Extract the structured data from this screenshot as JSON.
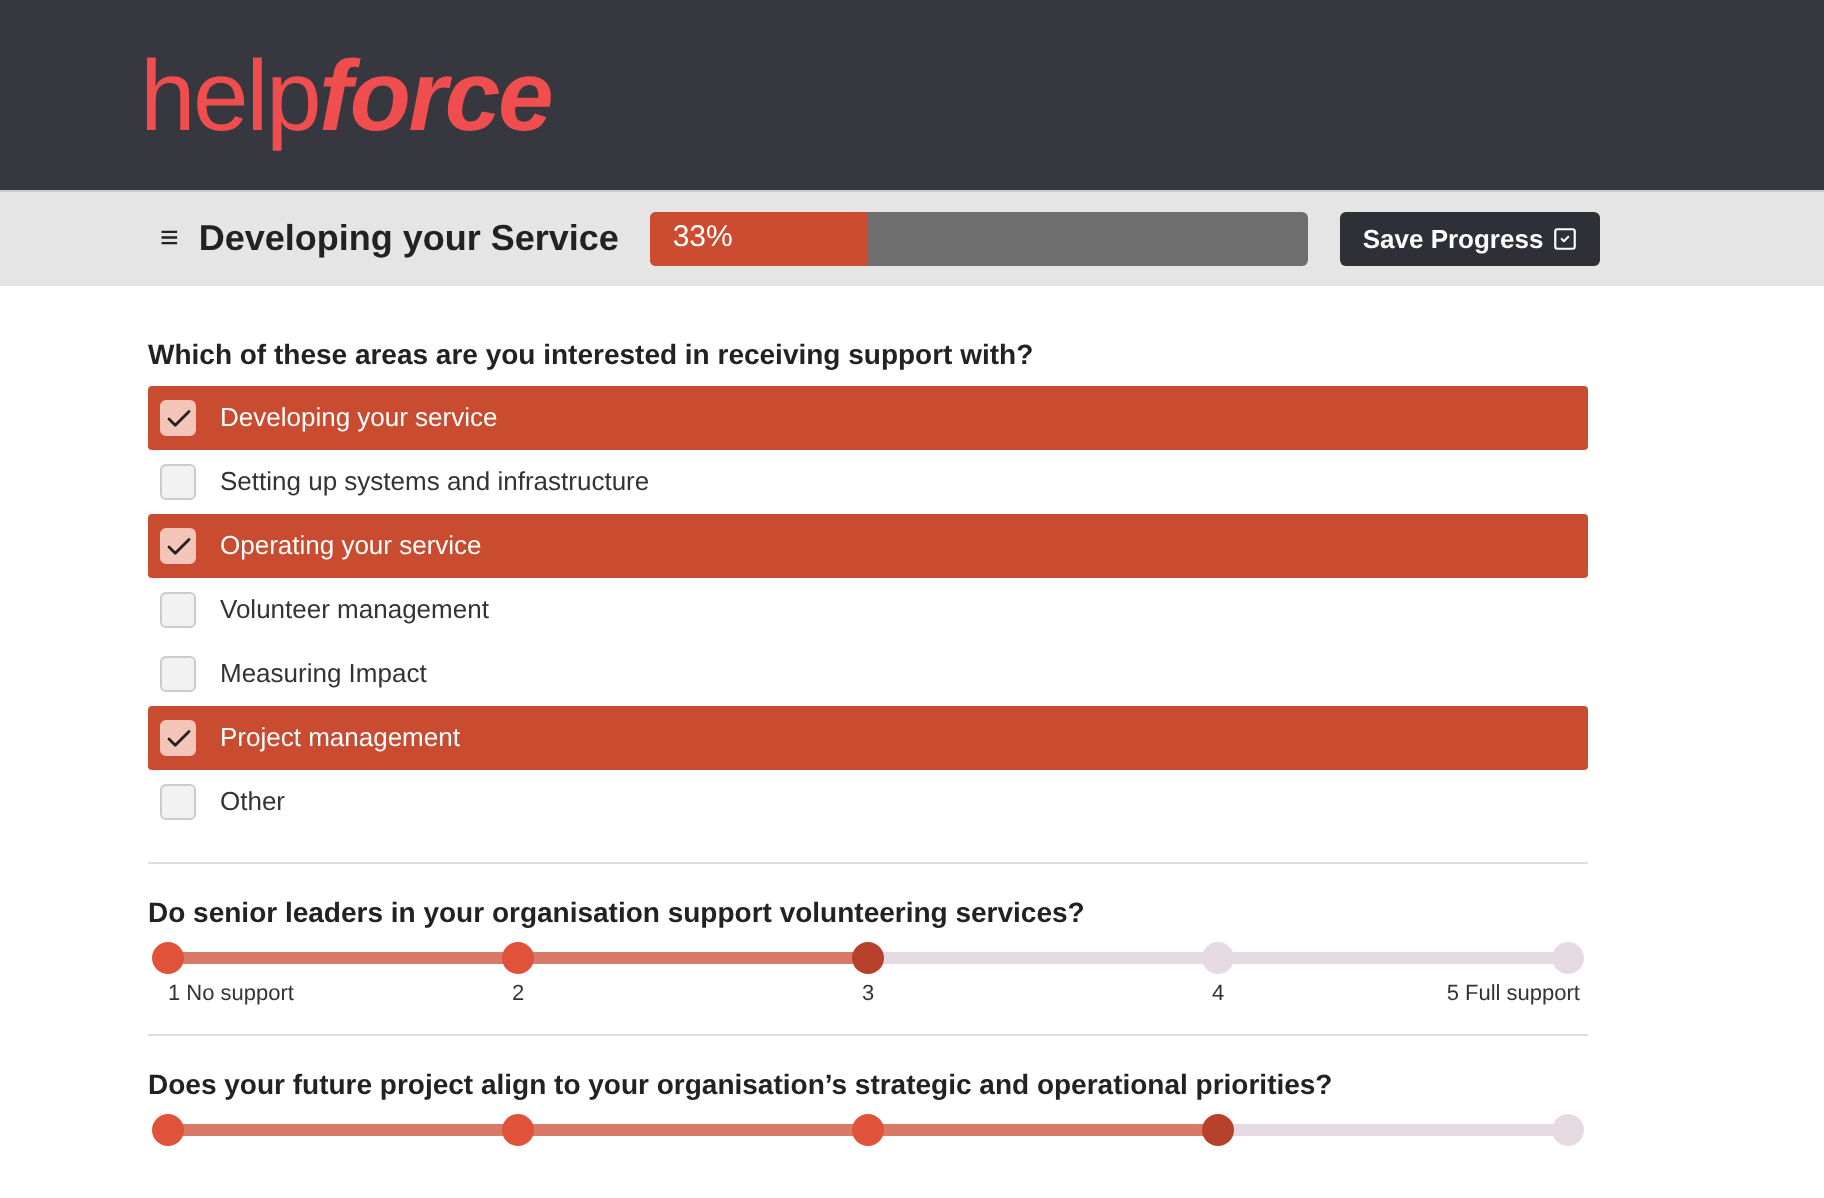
{
  "logo": {
    "text": "help",
    "emphasis": "force"
  },
  "toolbar": {
    "menu_icon": "≡",
    "title": "Developing your Service",
    "progress": {
      "level": 0.33,
      "reading": "33%"
    },
    "save_button": "Save Progress"
  },
  "questions": [
    {
      "kind": "checklist",
      "prompt": "Which of these areas are you interested in receiving support with?",
      "options": [
        {
          "label": "Developing your service",
          "checked": true
        },
        {
          "label": "Setting up systems and infrastructure",
          "checked": false
        },
        {
          "label": "Operating your service",
          "checked": true
        },
        {
          "label": "Volunteer management",
          "checked": false
        },
        {
          "label": "Measuring Impact",
          "checked": false
        },
        {
          "label": "Project management",
          "checked": true
        },
        {
          "label": "Other",
          "checked": false
        }
      ]
    },
    {
      "kind": "scale",
      "prompt": "Do senior leaders in your organisation support volunteering services?",
      "level": 0.5,
      "ticks": [
        "1 No support",
        "2",
        "3",
        "4",
        "5 Full support"
      ]
    },
    {
      "kind": "scale",
      "prompt": "Does your future project align to your organisation’s strategic and operational priorities?",
      "level": 0.75
    }
  ]
}
